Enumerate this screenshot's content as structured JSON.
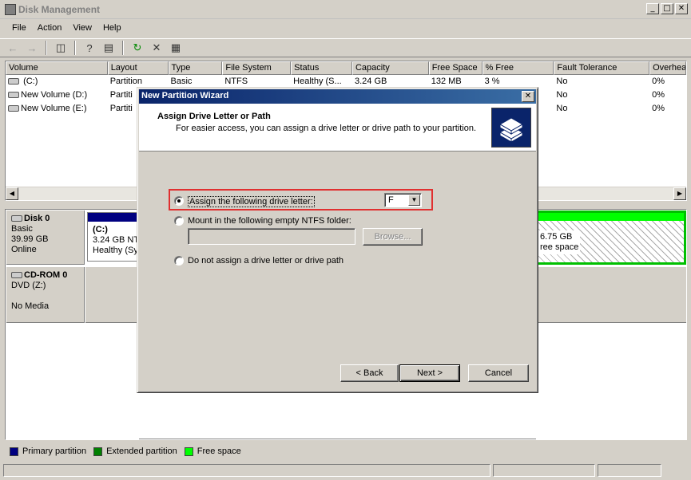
{
  "window": {
    "title": "Disk Management"
  },
  "menu": [
    "File",
    "Action",
    "View",
    "Help"
  ],
  "volume_list": {
    "columns": [
      "Volume",
      "Layout",
      "Type",
      "File System",
      "Status",
      "Capacity",
      "Free Space",
      "% Free",
      "Fault Tolerance",
      "Overhead"
    ],
    "rows": [
      {
        "volume": "(C:)",
        "layout": "Partition",
        "type": "Basic",
        "fs": "NTFS",
        "status": "Healthy (S...",
        "capacity": "3.24 GB",
        "free": "132 MB",
        "pct": "3 %",
        "fault": "No",
        "overhead": "0%"
      },
      {
        "volume": "New Volume (D:)",
        "layout": "Partiti",
        "type": "",
        "fs": "",
        "status": "",
        "capacity": "",
        "free": "",
        "pct": "",
        "fault": "No",
        "overhead": "0%"
      },
      {
        "volume": "New Volume (E:)",
        "layout": "Partiti",
        "type": "",
        "fs": "",
        "status": "",
        "capacity": "",
        "free": "",
        "pct": "",
        "fault": "No",
        "overhead": "0%"
      }
    ]
  },
  "disks": {
    "disk0": {
      "name": "Disk 0",
      "type": "Basic",
      "size": "39.99 GB",
      "state": "Online",
      "c_partition": {
        "name": "(C:)",
        "size": "3.24 GB NTI",
        "status": "Healthy (Sy"
      },
      "free_partition": {
        "size": "6.75 GB",
        "status": "ree space"
      }
    },
    "cdrom0": {
      "name": "CD-ROM 0",
      "drive": "DVD (Z:)",
      "media": "No Media"
    }
  },
  "legend": [
    {
      "label": "Primary partition",
      "color": "#000080"
    },
    {
      "label": "Extended partition",
      "color": "#008000"
    },
    {
      "label": "Free space",
      "color": "#00ff00"
    }
  ],
  "dialog": {
    "title": "New Partition Wizard",
    "header_title": "Assign Drive Letter or Path",
    "header_subtitle": "For easier access, you can assign a drive letter or drive path to your partition.",
    "option1": "Assign the following drive letter:",
    "drive_letter": "F",
    "option2": "Mount in the following empty NTFS folder:",
    "browse": "Browse...",
    "option3": "Do not assign a drive letter or drive path",
    "back": "< Back",
    "next": "Next >",
    "cancel": "Cancel"
  }
}
